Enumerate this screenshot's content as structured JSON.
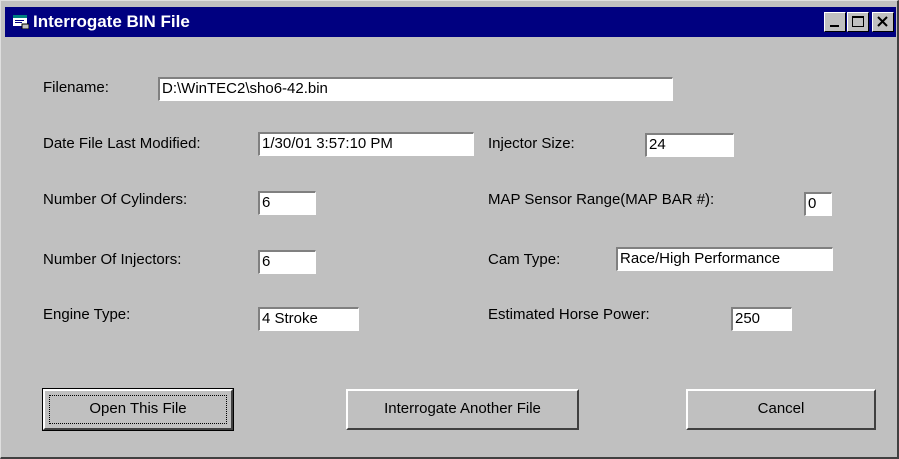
{
  "window": {
    "title": "Interrogate BIN File",
    "controls": [
      "minimize",
      "maximize",
      "close"
    ]
  },
  "form": {
    "filename": {
      "label": "Filename:",
      "value": "D:\\WinTEC2\\sho6-42.bin"
    },
    "date_modified": {
      "label": "Date File Last Modified:",
      "value": "1/30/01 3:57:10 PM"
    },
    "cylinders": {
      "label": "Number Of Cylinders:",
      "value": "6"
    },
    "injectors": {
      "label": "Number Of Injectors:",
      "value": "6"
    },
    "engine_type": {
      "label": "Engine Type:",
      "value": "4 Stroke"
    },
    "injector_size": {
      "label": "Injector Size:",
      "value": "24"
    },
    "map_sensor": {
      "label": "MAP Sensor Range(MAP BAR #):",
      "value": "0"
    },
    "cam_type": {
      "label": "Cam Type:",
      "value": "Race/High Performance"
    },
    "horse_power": {
      "label": "Estimated Horse Power:",
      "value": "250"
    }
  },
  "buttons": {
    "open": "Open This File",
    "interrogate_another": "Interrogate Another File",
    "cancel": "Cancel"
  },
  "colors": {
    "titlebar": "#000080",
    "face": "#c0c0c0",
    "field": "#ffffff"
  },
  "icons": {
    "app": "window-app-icon",
    "minimize": "minimize-icon",
    "maximize": "maximize-icon",
    "close": "close-icon"
  }
}
